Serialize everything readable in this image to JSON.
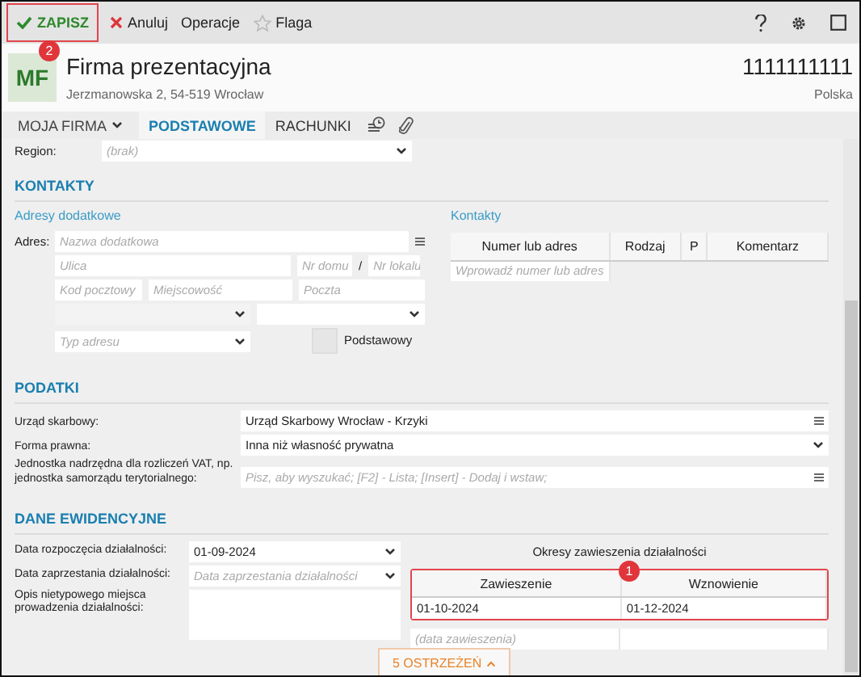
{
  "toolbar": {
    "save": "ZAPISZ",
    "save_badge": "2",
    "cancel": "Anuluj",
    "operations": "Operacje",
    "flag": "Flaga"
  },
  "header": {
    "avatar": "MF",
    "name": "Firma prezentacyjna",
    "address": "Jerzmanowska 2, 54-519 Wrocław",
    "nip": "1111111111",
    "country": "Polska"
  },
  "tabs": [
    {
      "label": "MOJA FIRMA",
      "kind": "menu",
      "selected": false
    },
    {
      "label": "PODSTAWOWE",
      "kind": "tab",
      "selected": true
    },
    {
      "label": "RACHUNKI",
      "kind": "tab",
      "selected": false
    }
  ],
  "region": {
    "label": "Region:",
    "placeholder": "(brak)"
  },
  "kontakty": {
    "title": "KONTAKTY",
    "addresses_title": "Adresy dodatkowe",
    "address_label": "Adres:",
    "name_placeholder": "Nazwa dodatkowa",
    "street_placeholder": "Ulica",
    "house_placeholder": "Nr domu",
    "slash": "/",
    "flat_placeholder": "Nr lokalu",
    "postcode_placeholder": "Kod pocztowy",
    "city_placeholder": "Miejscowość",
    "post_placeholder": "Poczta",
    "type_placeholder": "Typ adresu",
    "primary_label": "Podstawowy",
    "primary_checked": false,
    "contacts_title": "Kontakty",
    "columns": [
      "Numer lub adres",
      "Rodzaj",
      "P",
      "Komentarz"
    ],
    "contact_placeholder": "Wprowadź numer lub adres"
  },
  "podatki": {
    "title": "PODATKI",
    "rows": [
      {
        "label": "Urząd skarbowy:",
        "kind": "lookup",
        "value": "Urząd Skarbowy Wrocław - Krzyki"
      },
      {
        "label": "Forma prawna:",
        "kind": "select",
        "value": "Inna niż własność prywatna"
      },
      {
        "label": "Jednostka nadrzędna dla rozliczeń VAT, np. jednostka samorządu terytorialnego:",
        "kind": "lookup",
        "placeholder": "Pisz, aby wyszukać; [F2] - Lista; [Insert] - Dodaj i wstaw;"
      }
    ]
  },
  "ewidencja": {
    "title": "DANE EWIDENCYJNE",
    "start_label": "Data rozpoczęcia działalności:",
    "start_value": "01-09-2024",
    "end_label": "Data zaprzestania działalności:",
    "end_placeholder": "Data zaprzestania działalności",
    "desc_label": "Opis nietypowego miejsca prowadzenia działalności:",
    "periods_title": "Okresy zawieszenia działalności",
    "periods_badge": "1",
    "columns": [
      "Zawieszenie",
      "Wznowienie"
    ],
    "rows": [
      [
        "01-10-2024",
        "01-12-2024"
      ]
    ],
    "new_placeholder": "(data zawieszenia)"
  },
  "warnings": "5 OSTRZEŻEŃ"
}
